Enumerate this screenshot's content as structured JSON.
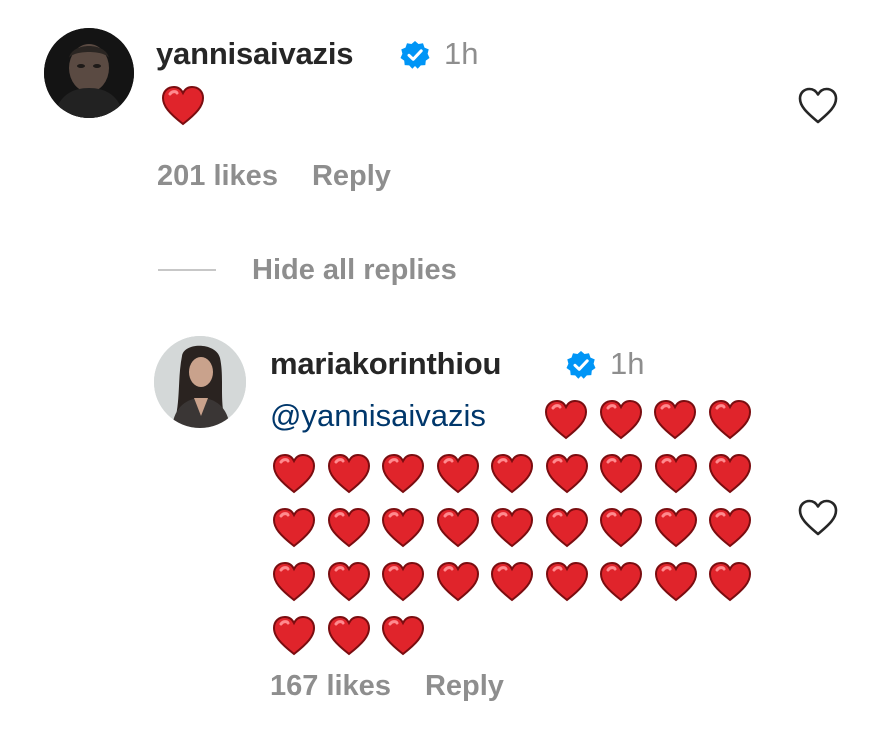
{
  "comment": {
    "username": "yannisaivazis",
    "time": "1h",
    "text_emoji": "red-heart",
    "likes": "201 likes",
    "reply_label": "Reply"
  },
  "hide_replies_label": "Hide all replies",
  "reply": {
    "username": "mariakorinthiou",
    "time": "1h",
    "mention": "@yannisaivazis",
    "heart_count": 34,
    "likes": "167 likes",
    "reply_label": "Reply"
  },
  "colors": {
    "text": "#262626",
    "muted": "#8e8e8e",
    "mention": "#00376b",
    "verified": "#0095f6",
    "heart": "#e0242b"
  },
  "icons": {
    "verified": "verified-badge-icon",
    "like": "heart-outline-icon",
    "emoji": "red-heart-emoji"
  }
}
